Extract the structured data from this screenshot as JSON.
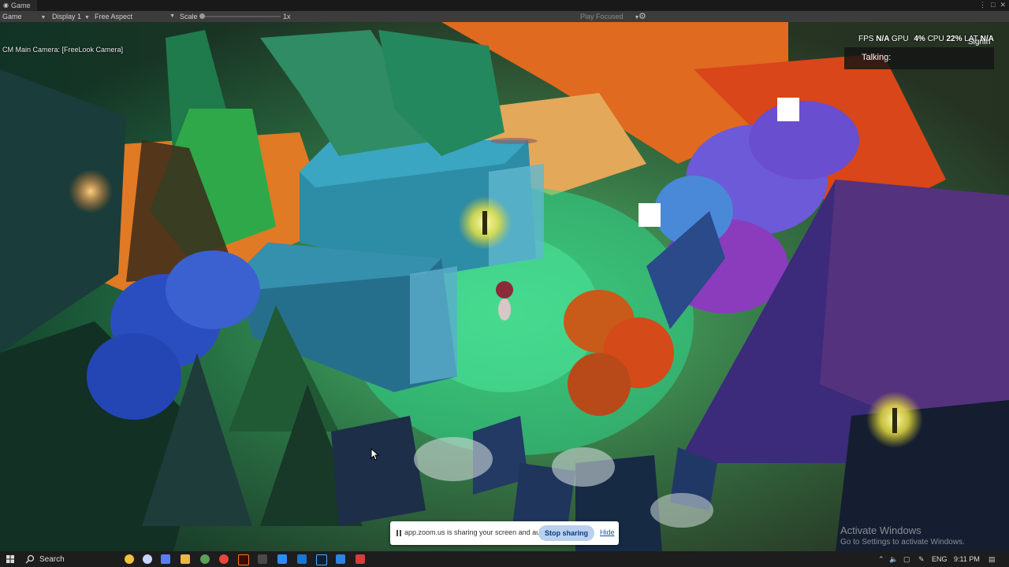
{
  "window": {
    "tab_title": "Game"
  },
  "toolbar": {
    "view_mode": "Game",
    "display": "Display 1",
    "aspect": "Free Aspect",
    "scale_label": "Scale",
    "scale_value": "1x",
    "play_mode": "Play Focused"
  },
  "overlay": {
    "camera_label": "CM Main Camera: [FreeLook Camera]",
    "stats": {
      "fps_label": "FPS",
      "fps_value": "N/A",
      "gpu_label": "GPU",
      "gpu_value": "4%",
      "cpu_label": "CPU",
      "cpu_value": "22%",
      "lat_label": "LAT",
      "lat_value": "N/A"
    },
    "sign_in": "SignIn",
    "talking_label": "Talking:"
  },
  "watermark": {
    "title": "Activate Windows",
    "subtitle": "Go to Settings to activate Windows."
  },
  "zoom_bar": {
    "message": "app.zoom.us is sharing your screen and audio.",
    "stop_label": "Stop sharing",
    "hide_label": "Hide"
  },
  "taskbar": {
    "search_label": "Search",
    "language": "ENG",
    "time": "9:11 PM",
    "pinned_icons": [
      "weather-icon",
      "copilot-icon",
      "file-explorer-icon",
      "nodejs-icon",
      "chrome-icon",
      "illustrator-icon",
      "unity-icon",
      "zoom-icon",
      "outlook-icon",
      "medibang-icon",
      "photoshop-icon",
      "vscode-icon",
      "app-icon"
    ]
  },
  "colors": {
    "editor_toolbar": "#3c3c3c",
    "zoom_stop_button": "#b9d1ee",
    "taskbar": "#1d1d1d"
  }
}
